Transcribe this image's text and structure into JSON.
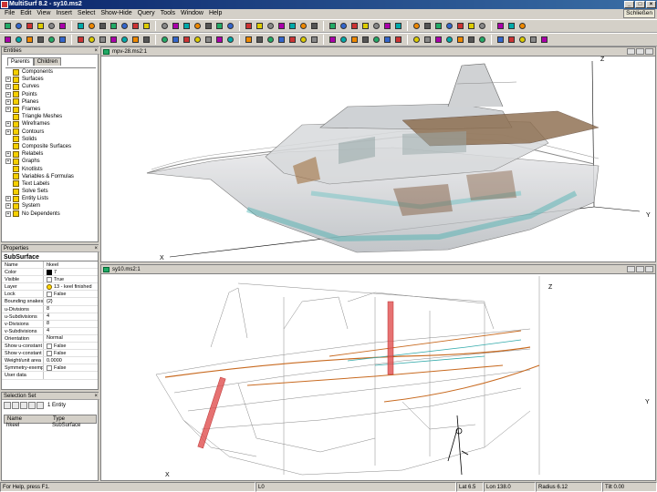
{
  "window": {
    "title": "MultiSurf 8.2 - sy10.ms2",
    "close_label": "Schließen"
  },
  "menu": [
    "File",
    "Edit",
    "View",
    "Insert",
    "Select",
    "Show-Hide",
    "Query",
    "Tools",
    "Window",
    "Help"
  ],
  "toolbar_icons": [
    "new-icon",
    "open-icon",
    "save-icon",
    "undo-icon",
    "point-icon",
    "curve-icon",
    "surface-icon",
    "snake-icon",
    "contour-icon",
    "frame-icon",
    "magnet-icon",
    "bead-icon",
    "ring-icon",
    "relabel-icon",
    "graph-icon",
    "wireframe-icon",
    "solid-icon",
    "view-front-icon",
    "view-side-icon",
    "view-top-icon",
    "view-iso-icon",
    "zoom-in-icon",
    "zoom-out-icon",
    "pan-icon",
    "rotate-icon",
    "select-icon",
    "help-icon"
  ],
  "entities": {
    "header": "Entities",
    "tabs": [
      "Parents",
      "Children"
    ],
    "items": [
      {
        "label": "Components",
        "expandable": false
      },
      {
        "label": "Surfaces",
        "expandable": true
      },
      {
        "label": "Curves",
        "expandable": true
      },
      {
        "label": "Points",
        "expandable": true
      },
      {
        "label": "Planes",
        "expandable": true
      },
      {
        "label": "Frames",
        "expandable": true
      },
      {
        "label": "Triangle Meshes",
        "expandable": false
      },
      {
        "label": "Wireframes",
        "expandable": true
      },
      {
        "label": "Contours",
        "expandable": true
      },
      {
        "label": "Solids",
        "expandable": false
      },
      {
        "label": "Composite Surfaces",
        "expandable": false
      },
      {
        "label": "Relabels",
        "expandable": true
      },
      {
        "label": "Graphs",
        "expandable": true
      },
      {
        "label": "Knotlists",
        "expandable": false
      },
      {
        "label": "Variables & Formulas",
        "expandable": false
      },
      {
        "label": "Text Labels",
        "expandable": false
      },
      {
        "label": "Solve Sets",
        "expandable": false
      },
      {
        "label": "Entity Lists",
        "expandable": true
      },
      {
        "label": "System",
        "expandable": true
      },
      {
        "label": "No Dependents",
        "expandable": true
      }
    ]
  },
  "properties": {
    "header": "Properties",
    "entity_type": "SubSurface",
    "rows": [
      {
        "key": "Name",
        "value": "hkeel",
        "widget": "none"
      },
      {
        "key": "Color",
        "value": "7",
        "widget": "swatch"
      },
      {
        "key": "Visible",
        "value": "True",
        "widget": "check"
      },
      {
        "key": "Layer",
        "value": "13 - keel finished",
        "widget": "bulb"
      },
      {
        "key": "Lock",
        "value": "False",
        "widget": "check"
      },
      {
        "key": "Bounding snakes",
        "value": "{2}",
        "widget": "none"
      },
      {
        "key": "u-Divisions",
        "value": "8",
        "widget": "none"
      },
      {
        "key": "u-Subdivisions",
        "value": "4",
        "widget": "none"
      },
      {
        "key": "v-Divisions",
        "value": "8",
        "widget": "none"
      },
      {
        "key": "v-Subdivisions",
        "value": "4",
        "widget": "none"
      },
      {
        "key": "Orientation",
        "value": "Normal",
        "widget": "none"
      },
      {
        "key": "Show u-constant",
        "value": "False",
        "widget": "check"
      },
      {
        "key": "Show v-constant",
        "value": "False",
        "widget": "check"
      },
      {
        "key": "Weight/unit area",
        "value": "0.0000",
        "widget": "none"
      },
      {
        "key": "Symmetry-exempt",
        "value": "False",
        "widget": "check"
      },
      {
        "key": "User data",
        "value": "",
        "widget": "none"
      }
    ]
  },
  "selection_set": {
    "header": "Selection Set",
    "count": "1 Entity",
    "columns": [
      "Name",
      "Type"
    ],
    "rows": [
      {
        "name": "hkeel",
        "type": "SubSurface"
      }
    ]
  },
  "viewports": [
    {
      "title": "mpv-28.ms2:1",
      "axes": {
        "z": "Z",
        "x": "X",
        "y": "Y"
      }
    },
    {
      "title": "sy10.ms2:1",
      "axes": {
        "z": "Z",
        "x": "X",
        "y": "Y"
      }
    }
  ],
  "status": {
    "help": "For Help, press F1.",
    "layer": "L0",
    "lat": "Lat 6.5",
    "lon": "Lon 138.0",
    "radius": "Radius 6.12",
    "tilt": "Tilt 0.00"
  }
}
